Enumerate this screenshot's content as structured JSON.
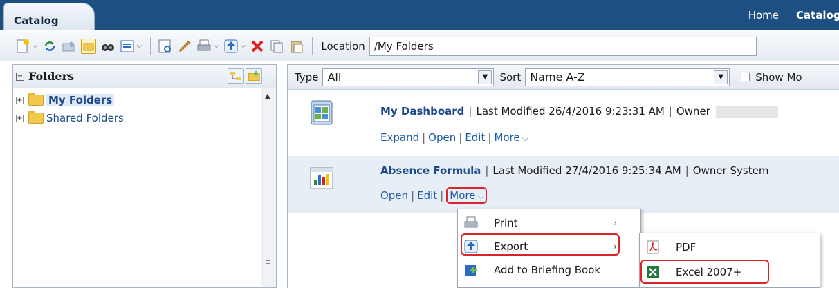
{
  "header": {
    "tab_label": "Catalog",
    "home_link": "Home",
    "catalog_link": "Catalog"
  },
  "toolbar": {
    "location_label": "Location",
    "location_value": "/My Folders",
    "icons": [
      "new-icon",
      "refresh-icon",
      "folder-up-icon",
      "folder-tree-icon",
      "search-binoculars-icon",
      "view-icon",
      "properties-icon",
      "edit-pencil-icon",
      "print-icon",
      "export-icon",
      "delete-icon",
      "copy-icon",
      "paste-icon"
    ]
  },
  "left_pane": {
    "title": "Folders",
    "tree": [
      {
        "label": "My Folders",
        "selected": true
      },
      {
        "label": "Shared Folders",
        "selected": false
      }
    ]
  },
  "right_pane": {
    "filter": {
      "type_label": "Type",
      "type_value": "All",
      "sort_label": "Sort",
      "sort_value": "Name A-Z",
      "show_more_label": "Show Mo"
    },
    "items": [
      {
        "name": "My Dashboard",
        "modified_label": "Last Modified",
        "modified_value": "26/4/2016 9:23:31 AM",
        "owner_label": "Owner",
        "owner_value": "",
        "actions": [
          "Expand",
          "Open",
          "Edit",
          "More"
        ]
      },
      {
        "name": "Absence Formula",
        "modified_label": "Last Modified",
        "modified_value": "27/4/2016 9:25:34 AM",
        "owner_label": "Owner",
        "owner_value": "System",
        "actions": [
          "Open",
          "Edit",
          "More"
        ]
      }
    ]
  },
  "more_menu": {
    "items": [
      "Print",
      "Export",
      "Add to Briefing Book"
    ]
  },
  "export_menu": {
    "items": [
      "PDF",
      "Excel 2007+"
    ]
  },
  "colors": {
    "header_bg": "#1d4f82",
    "link": "#1e5aa8",
    "highlight": "#d9242a",
    "selected_row": "#e8eef6"
  }
}
